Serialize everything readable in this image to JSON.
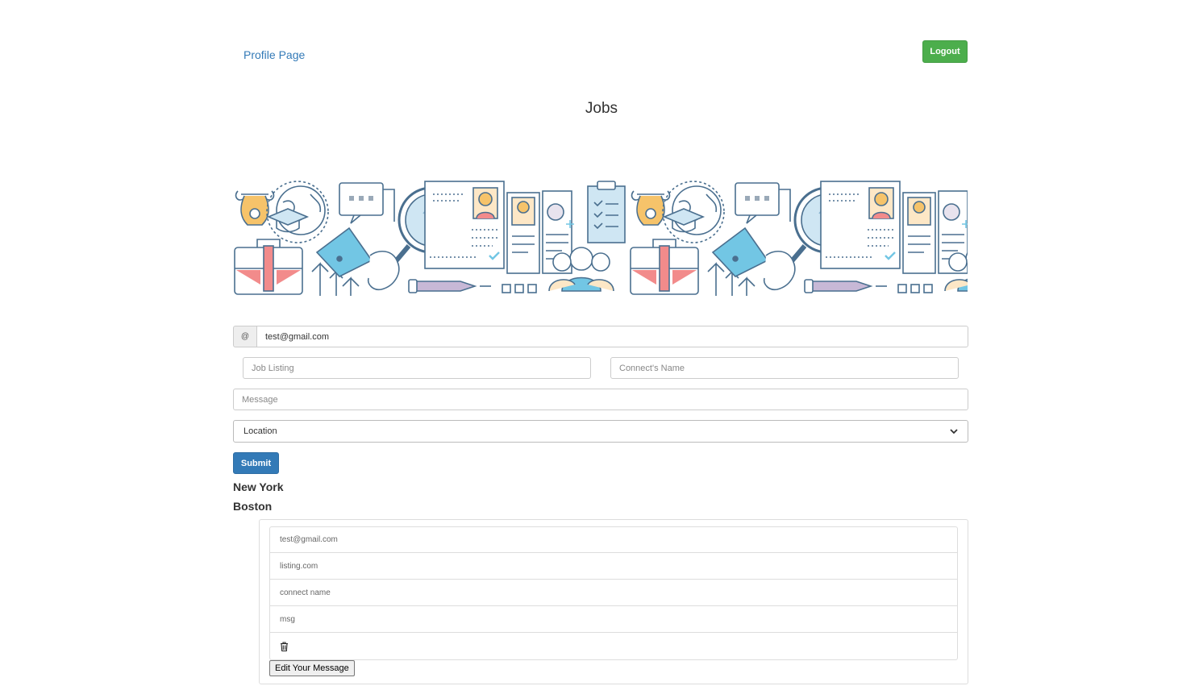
{
  "header": {
    "profile_link": "Profile Page",
    "logout_label": "Logout",
    "title": "Jobs"
  },
  "form": {
    "email_addon": "@",
    "email_value": "test@gmail.com",
    "job_listing_placeholder": "Job Listing",
    "connect_name_placeholder": "Connect's Name",
    "message_placeholder": "Message",
    "location_selected": "Location",
    "submit_label": "Submit"
  },
  "cities": [
    "New York",
    "Boston"
  ],
  "card": {
    "email": "test@gmail.com",
    "listing": "listing.com",
    "connect_name": "connect name",
    "message": "msg",
    "trash_icon": "trash-icon",
    "edit_label": "Edit Your Message"
  },
  "colors": {
    "link": "#337ab7",
    "logout": "#4cae4c",
    "submit": "#337ab7"
  }
}
